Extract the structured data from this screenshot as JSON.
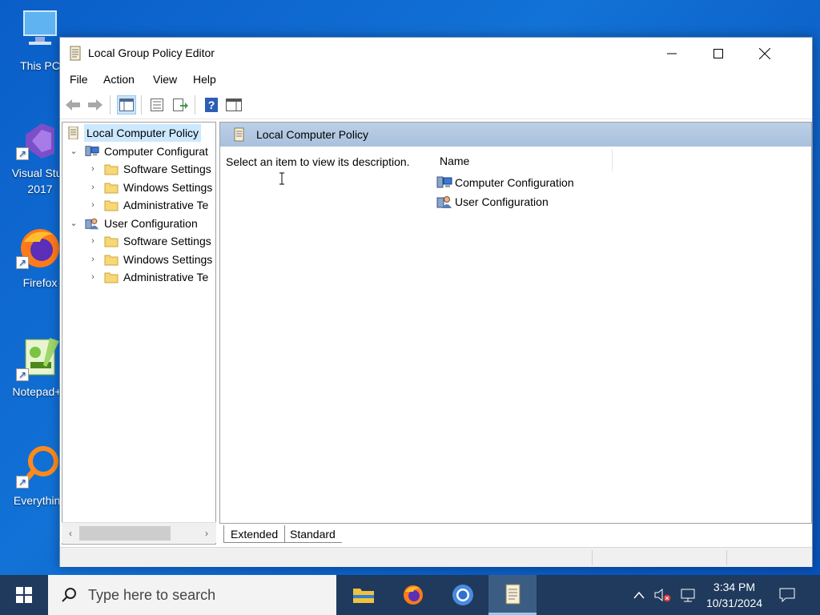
{
  "desktop": {
    "icons": [
      {
        "label": "This PC",
        "icon": "this-pc-icon"
      },
      {
        "label": "Visual Stud",
        "label2": "2017",
        "icon": "visual-studio-icon"
      },
      {
        "label": "Firefox",
        "icon": "firefox-icon"
      },
      {
        "label": "Notepad++",
        "icon": "notepad-plus-plus-icon"
      },
      {
        "label": "Everything",
        "icon": "everything-search-icon"
      }
    ]
  },
  "window": {
    "title": "Local Group Policy Editor",
    "menu": [
      "File",
      "Action",
      "View",
      "Help"
    ],
    "toolbar": [
      "back-icon",
      "forward-icon",
      "show-hide-console-tree-icon",
      "properties-icon",
      "export-list-icon",
      "help-icon",
      "show-action-pane-icon"
    ]
  },
  "tree": {
    "root": "Local Computer Policy",
    "computer": "Computer Configurat",
    "user": "User Configuration",
    "computer_children": [
      "Software Settings",
      "Windows Settings",
      "Administrative Te"
    ],
    "user_children": [
      "Software Settings",
      "Windows Settings",
      "Administrative Te"
    ]
  },
  "main": {
    "header_title": "Local Computer Policy",
    "description": "Select an item to view its description.",
    "column_name": "Name",
    "items": [
      "Computer Configuration",
      "User Configuration"
    ],
    "tabs": [
      "Extended",
      "Standard"
    ]
  },
  "taskbar": {
    "search_placeholder": "Type here to search",
    "time": "3:34 PM",
    "date": "10/31/2024"
  },
  "colors": {
    "taskbar": "#1f3a5c",
    "desktop": "#0a5ec8",
    "header_band": "#a9c1dd",
    "selection": "#cce8ff"
  }
}
